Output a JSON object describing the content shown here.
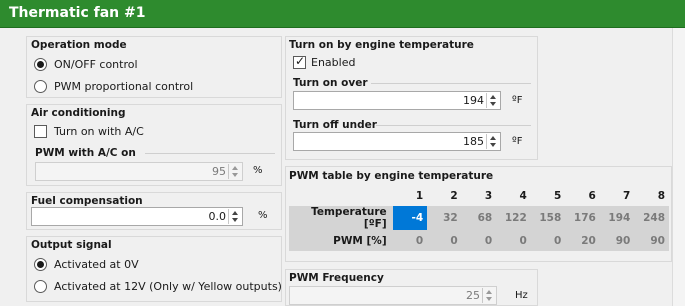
{
  "window": {
    "title": "Thermatic fan #1"
  },
  "operation_mode": {
    "title": "Operation mode",
    "options": [
      {
        "label": "ON/OFF control",
        "selected": true
      },
      {
        "label": "PWM proportional control",
        "selected": false
      }
    ]
  },
  "air_conditioning": {
    "title": "Air conditioning",
    "turn_on_label": "Turn on with A/C",
    "turn_on_checked": false,
    "pwm_label": "PWM with A/C on",
    "pwm_value": "95",
    "pwm_unit": "%"
  },
  "fuel_compensation": {
    "title": "Fuel compensation",
    "value": "0.0",
    "unit": "%"
  },
  "output_signal": {
    "title": "Output signal",
    "options": [
      {
        "label": "Activated at 0V",
        "selected": true
      },
      {
        "label": "Activated at 12V (Only w/ Yellow outputs)",
        "selected": false
      }
    ]
  },
  "engine_temp": {
    "title": "Turn on by engine temperature",
    "enabled_label": "Enabled",
    "enabled_checked": true,
    "turn_on_label": "Turn on over",
    "turn_on_value": "194",
    "turn_off_label": "Turn off under",
    "turn_off_value": "185",
    "unit": "ºF"
  },
  "pwm_table": {
    "title": "PWM table by engine temperature",
    "columns": [
      "1",
      "2",
      "3",
      "4",
      "5",
      "6",
      "7",
      "8"
    ],
    "temperature_label": "Temperature [ºF]",
    "temperature": [
      "-4",
      "32",
      "68",
      "122",
      "158",
      "176",
      "194",
      "248"
    ],
    "pwm_label": "PWM [%]",
    "pwm": [
      "0",
      "0",
      "0",
      "0",
      "0",
      "20",
      "90",
      "90"
    ],
    "selected_cell": "temperature-1",
    "selected_color": "#0078d7"
  },
  "pwm_frequency": {
    "title": "PWM Frequency",
    "value": "25",
    "unit": "Hz"
  },
  "colors": {
    "titlebar": "#2e8b2e",
    "background": "#f0f0f0"
  }
}
